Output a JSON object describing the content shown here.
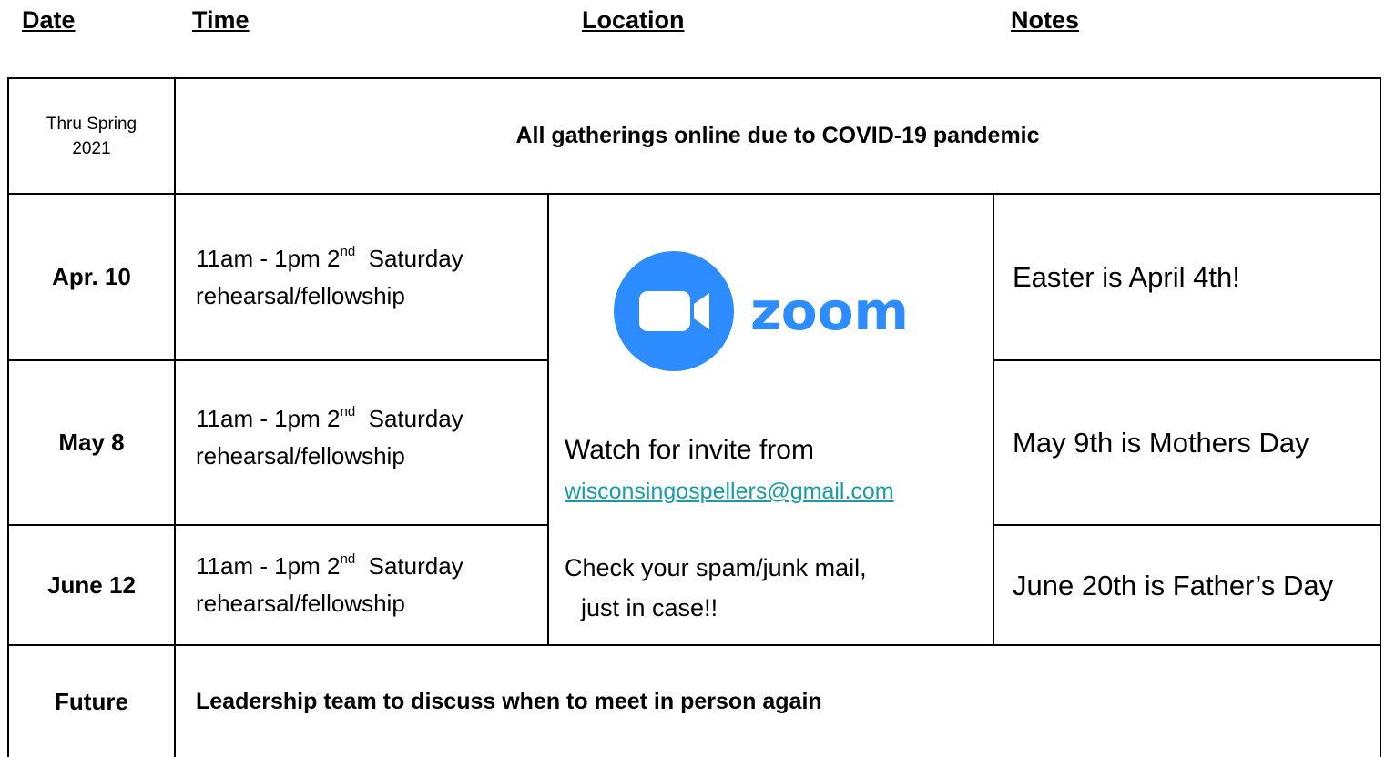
{
  "headers": {
    "date": "Date",
    "time": "Time",
    "location": "Location",
    "notes": "Notes"
  },
  "banner": {
    "date": "Thru Spring\n2021",
    "text": "All gatherings online due to COVID-19 pandemic"
  },
  "rows": [
    {
      "date": "Apr. 10",
      "time_prefix": "11am - 1pm 2",
      "time_sup": "nd",
      "time_suffix": "  Saturday",
      "time_line2": "rehearsal/fellowship",
      "note": "Easter is April 4th!"
    },
    {
      "date": "May 8",
      "time_prefix": "11am - 1pm 2",
      "time_sup": "nd",
      "time_suffix": "  Saturday",
      "time_line2": "rehearsal/fellowship",
      "note": "May 9th is Mothers Day"
    },
    {
      "date": "June 12",
      "time_prefix": "11am - 1pm 2",
      "time_sup": "nd",
      "time_suffix": "  Saturday",
      "time_line2": "rehearsal/fellowship",
      "note": "June 20th is Father’s Day"
    }
  ],
  "location": {
    "logo_text": "zoom",
    "logo_color": "#2d8cff",
    "watch_text": "Watch for invite from",
    "email": "wisconsingospellers@gmail.com",
    "spam_line1": "Check your spam/junk mail,",
    "spam_line2": "just in case!!"
  },
  "future": {
    "date": "Future",
    "text": "Leadership team to discuss when to meet in person again"
  }
}
